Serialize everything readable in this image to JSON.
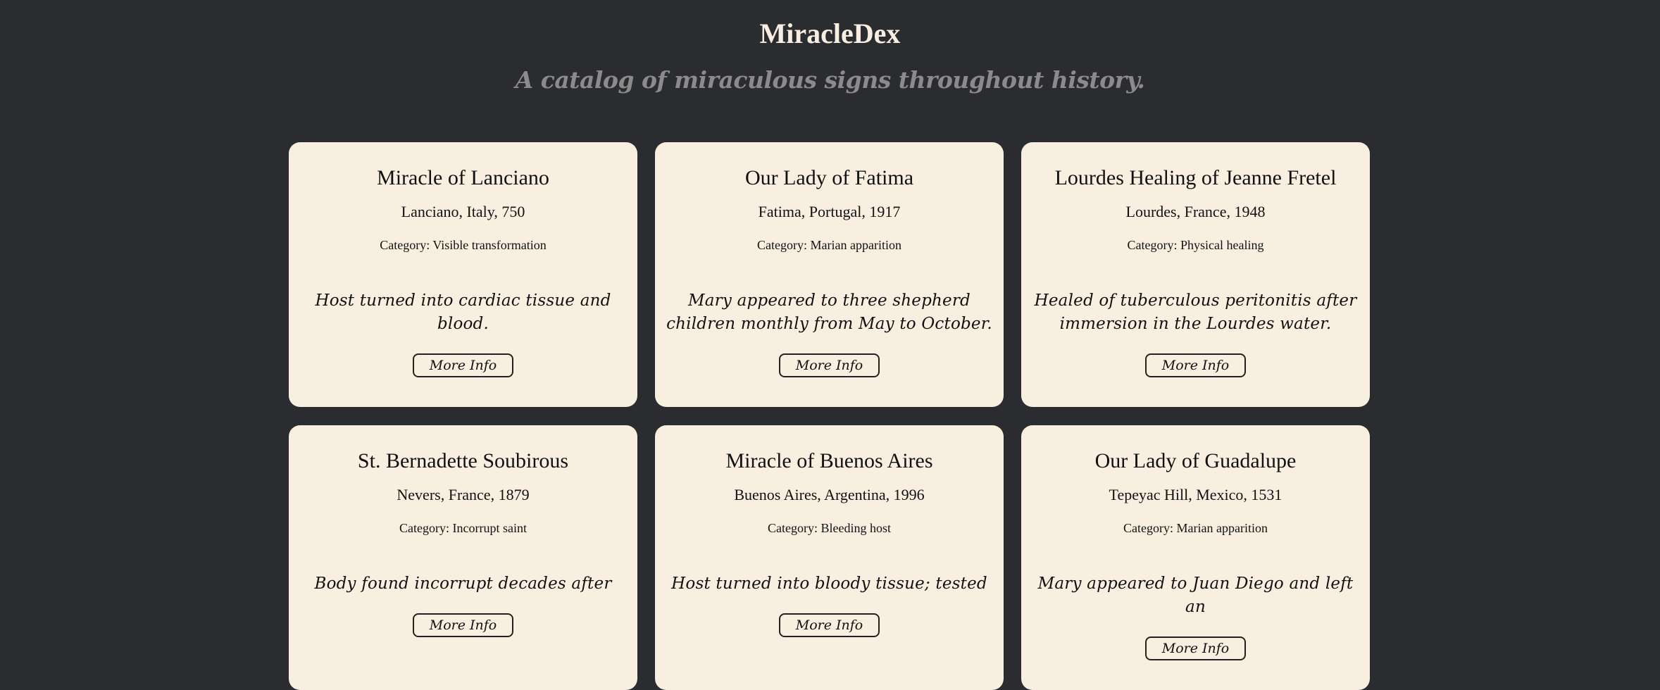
{
  "header": {
    "title": "MiracleDex",
    "subtitle": "A catalog of miraculous signs throughout history."
  },
  "cards": [
    {
      "title": "Miracle of Lanciano",
      "location": "Lanciano, Italy, 750",
      "category": "Category: Visible transformation",
      "description": "Host turned into cardiac tissue and blood.",
      "button": "More Info"
    },
    {
      "title": "Our Lady of Fatima",
      "location": "Fatima, Portugal, 1917",
      "category": "Category: Marian apparition",
      "description": "Mary appeared to three shepherd children monthly from May to October.",
      "button": "More Info"
    },
    {
      "title": "Lourdes Healing of Jeanne Fretel",
      "location": "Lourdes, France, 1948",
      "category": "Category: Physical healing",
      "description": "Healed of tuberculous peritonitis after immersion in the Lourdes water.",
      "button": "More Info"
    },
    {
      "title": "St. Bernadette Soubirous",
      "location": "Nevers, France, 1879",
      "category": "Category: Incorrupt saint",
      "description": "Body found incorrupt decades after",
      "button": "More Info"
    },
    {
      "title": "Miracle of Buenos Aires",
      "location": "Buenos Aires, Argentina, 1996",
      "category": "Category: Bleeding host",
      "description": "Host turned into bloody tissue; tested",
      "button": "More Info"
    },
    {
      "title": "Our Lady of Guadalupe",
      "location": "Tepeyac Hill, Mexico, 1531",
      "category": "Category: Marian apparition",
      "description": "Mary appeared to Juan Diego and left an",
      "button": "More Info"
    }
  ]
}
